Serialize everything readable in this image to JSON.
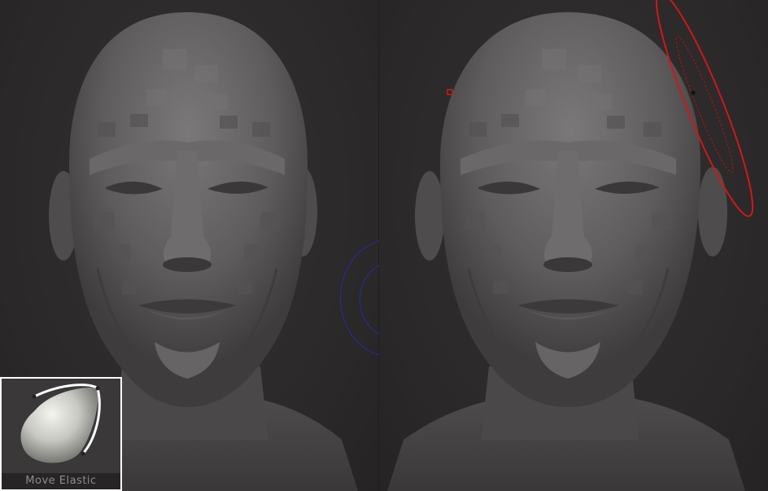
{
  "brush": {
    "label": "Move Elastic"
  },
  "colors": {
    "background": "#2c2a2a",
    "mesh": "#5e5c5c",
    "brush_cursor_left": "#2a2aa8",
    "brush_cursor_right": "#d01818",
    "thumbnail_frame": "#ffffff"
  },
  "icons": {
    "brush_icon": "move-elastic-brush-icon",
    "cursor_left": "brush-cursor-blue-icon",
    "cursor_right": "brush-cursor-red-icon"
  }
}
